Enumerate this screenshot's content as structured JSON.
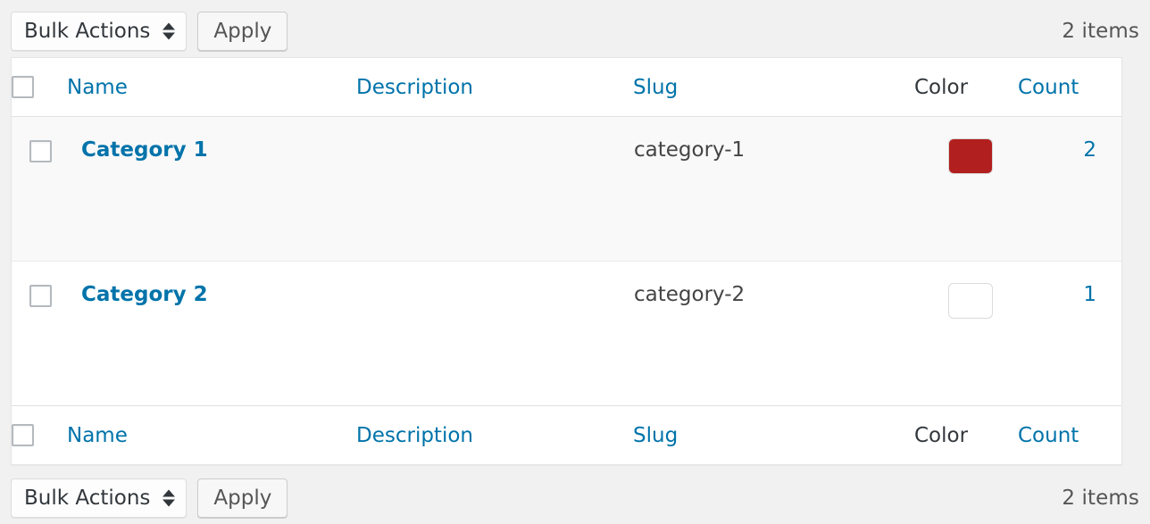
{
  "toolbar_top": {
    "bulk_actions_label": "Bulk Actions",
    "apply_label": "Apply",
    "items_count": "2 items"
  },
  "toolbar_bottom": {
    "bulk_actions_label": "Bulk Actions",
    "apply_label": "Apply",
    "items_count": "2 items"
  },
  "table": {
    "columns": [
      {
        "key": "cb",
        "label": "",
        "link": false
      },
      {
        "key": "name",
        "label": "Name",
        "link": true
      },
      {
        "key": "desc",
        "label": "Description",
        "link": true
      },
      {
        "key": "slug",
        "label": "Slug",
        "link": true
      },
      {
        "key": "color",
        "label": "Color",
        "link": false
      },
      {
        "key": "count",
        "label": "Count",
        "link": true
      }
    ],
    "rows": [
      {
        "name": "Category 1",
        "description": "",
        "slug": "category-1",
        "color": "#b21f1f",
        "has_color": true,
        "count": "2"
      },
      {
        "name": "Category 2",
        "description": "",
        "slug": "category-2",
        "color": "",
        "has_color": false,
        "count": "1"
      }
    ]
  },
  "colors": {
    "link": "#0073aa",
    "page_background": "#f1f1f1",
    "row_alternate": "#f9f9f9",
    "swatch_1": "#b21f1f"
  }
}
